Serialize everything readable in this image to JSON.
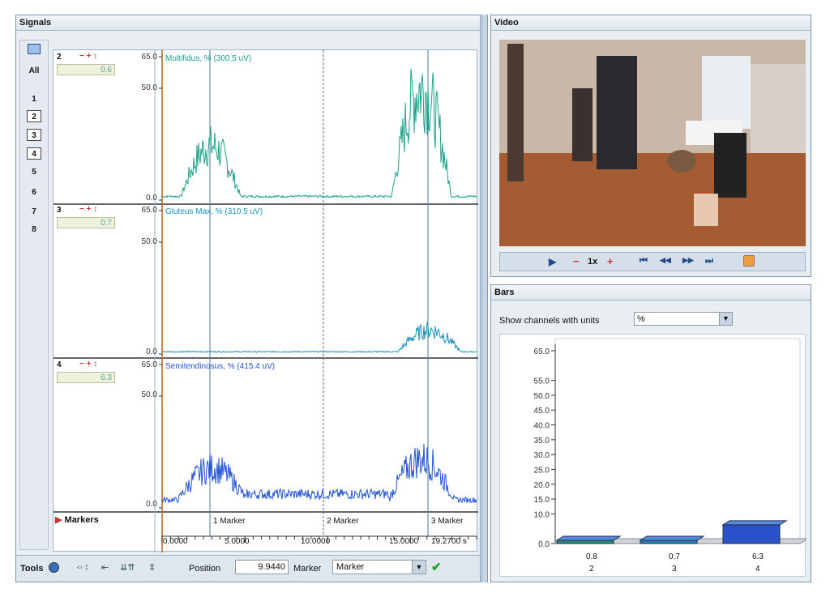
{
  "signals": {
    "title": "Signals",
    "all_label": "All",
    "channel_buttons": [
      "1",
      "2",
      "3",
      "4",
      "5",
      "6",
      "7",
      "8"
    ],
    "channels": [
      {
        "number": "2",
        "controls": "− + ↕",
        "value": "0.6",
        "ymax": "65.0",
        "ymid": "50.0",
        "ymin": "0.0",
        "label": "Multifidus, % (300.5 uV)",
        "color": "#1aa38a"
      },
      {
        "number": "3",
        "controls": "− + ↕",
        "value": "0.7",
        "ymax": "65.0",
        "ymid": "50.0",
        "ymin": "0.0",
        "label": "Gluteus Max, % (310.5 uV)",
        "color": "#1b8fc0"
      },
      {
        "number": "4",
        "controls": "− + ↕",
        "value": "6.3",
        "ymax": "65.0",
        "ymid": "50.0",
        "ymin": "0.0",
        "label": "Semitendinosus, % (415.4 uV)",
        "color": "#2355d6"
      }
    ],
    "markers_label": "Markers",
    "marker_labels": [
      "1 Marker",
      "2 Marker",
      "3 Marker"
    ],
    "time_ticks": [
      "0.0000",
      "5.0000",
      "10.0000",
      "15.0000",
      "19.2700 s"
    ]
  },
  "tools": {
    "label": "Tools",
    "position_label": "Position",
    "position_value": "9.9440",
    "marker_label": "Marker",
    "marker_select_value": "Marker"
  },
  "video": {
    "title": "Video",
    "speed": "1x",
    "controls": {
      "play": "▶",
      "minus": "−",
      "plus": "+",
      "first": "⏮",
      "prev": "◀◀",
      "next": "▶▶",
      "last": "⏭"
    }
  },
  "bars": {
    "title": "Bars",
    "filter_label": "Show channels with units",
    "filter_value": "%",
    "y_ticks": [
      "65.0",
      "55.0",
      "50.0",
      "45.0",
      "40.0",
      "35.0",
      "30.0",
      "25.0",
      "20.0",
      "15.0",
      "10.0",
      "0.0"
    ],
    "values": [
      "0.8",
      "0.7",
      "6.3"
    ],
    "channels": [
      "2",
      "3",
      "4"
    ],
    "bar_colors": [
      "#2a8a78",
      "#2b7ab0",
      "#2b52c8"
    ]
  }
}
